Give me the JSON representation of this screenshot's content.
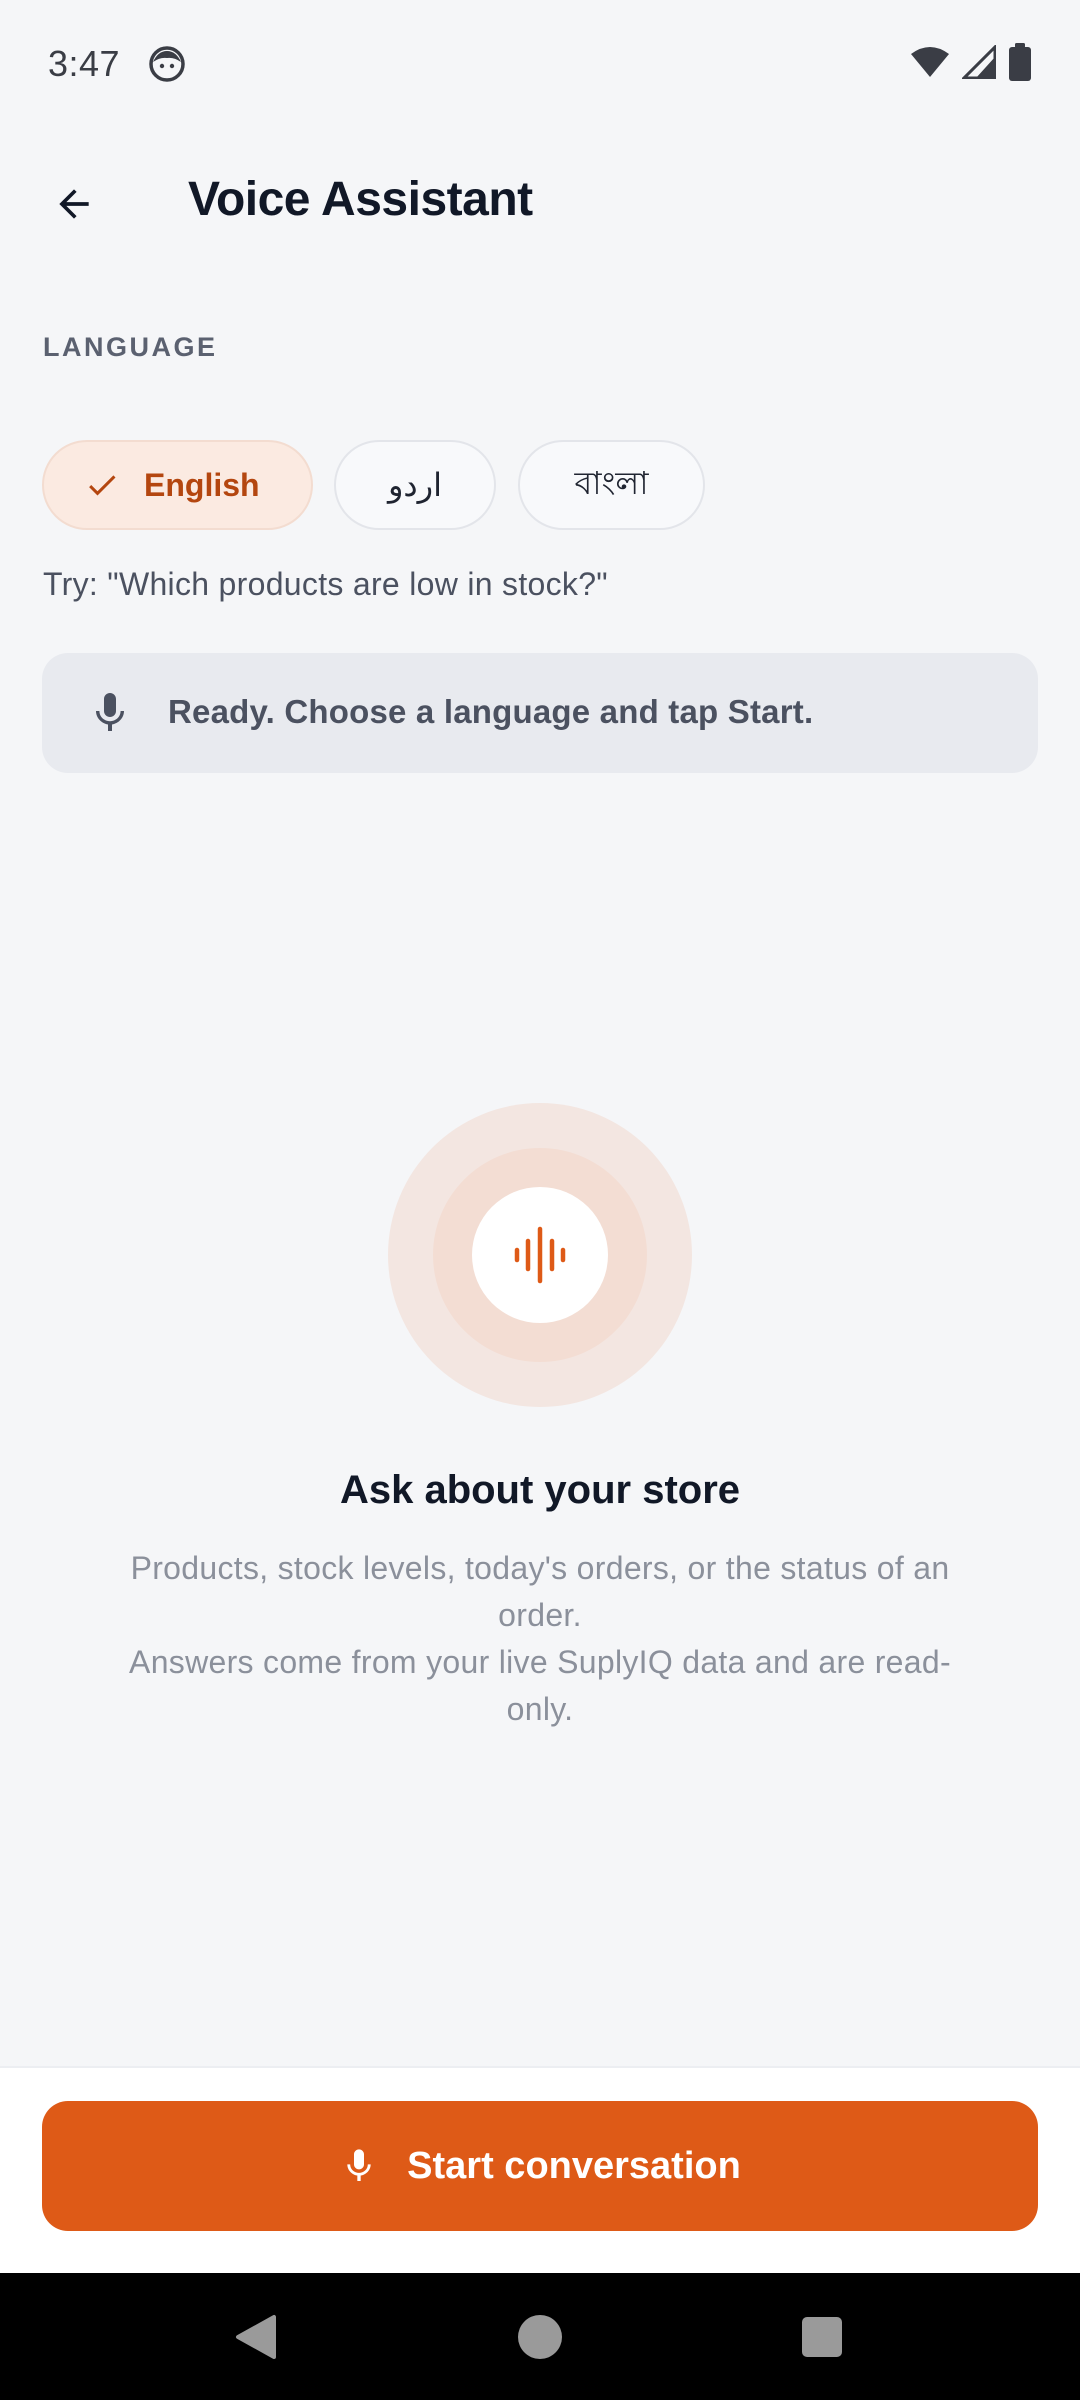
{
  "status_bar": {
    "time": "3:47",
    "icons": [
      "face-icon",
      "wifi-icon",
      "signal-icon",
      "battery-icon"
    ]
  },
  "app_bar": {
    "title": "Voice Assistant",
    "back_icon": "arrow-back-icon"
  },
  "language": {
    "section_label": "LANGUAGE",
    "options": [
      {
        "label": "English",
        "selected": true
      },
      {
        "label": "اردو",
        "selected": false
      },
      {
        "label": "বাংলা",
        "selected": false
      }
    ]
  },
  "hint": "Try: \"Which products are low in stock?\"",
  "status_card": {
    "icon": "mic-icon",
    "text": "Ready. Choose a language and tap Start."
  },
  "empty_state": {
    "icon": "waveform-icon",
    "title": "Ask about your store",
    "line1": "Products, stock levels, today's orders, or the status of an order.",
    "line2": "Answers come from your live SuplyIQ data and are read-only."
  },
  "action": {
    "button_label": "Start conversation",
    "button_icon": "mic-icon"
  },
  "colors": {
    "accent": "#de5a17",
    "selected_chip_bg": "#fbeae1",
    "selected_chip_text": "#b4460f",
    "background": "#f5f6f8"
  }
}
